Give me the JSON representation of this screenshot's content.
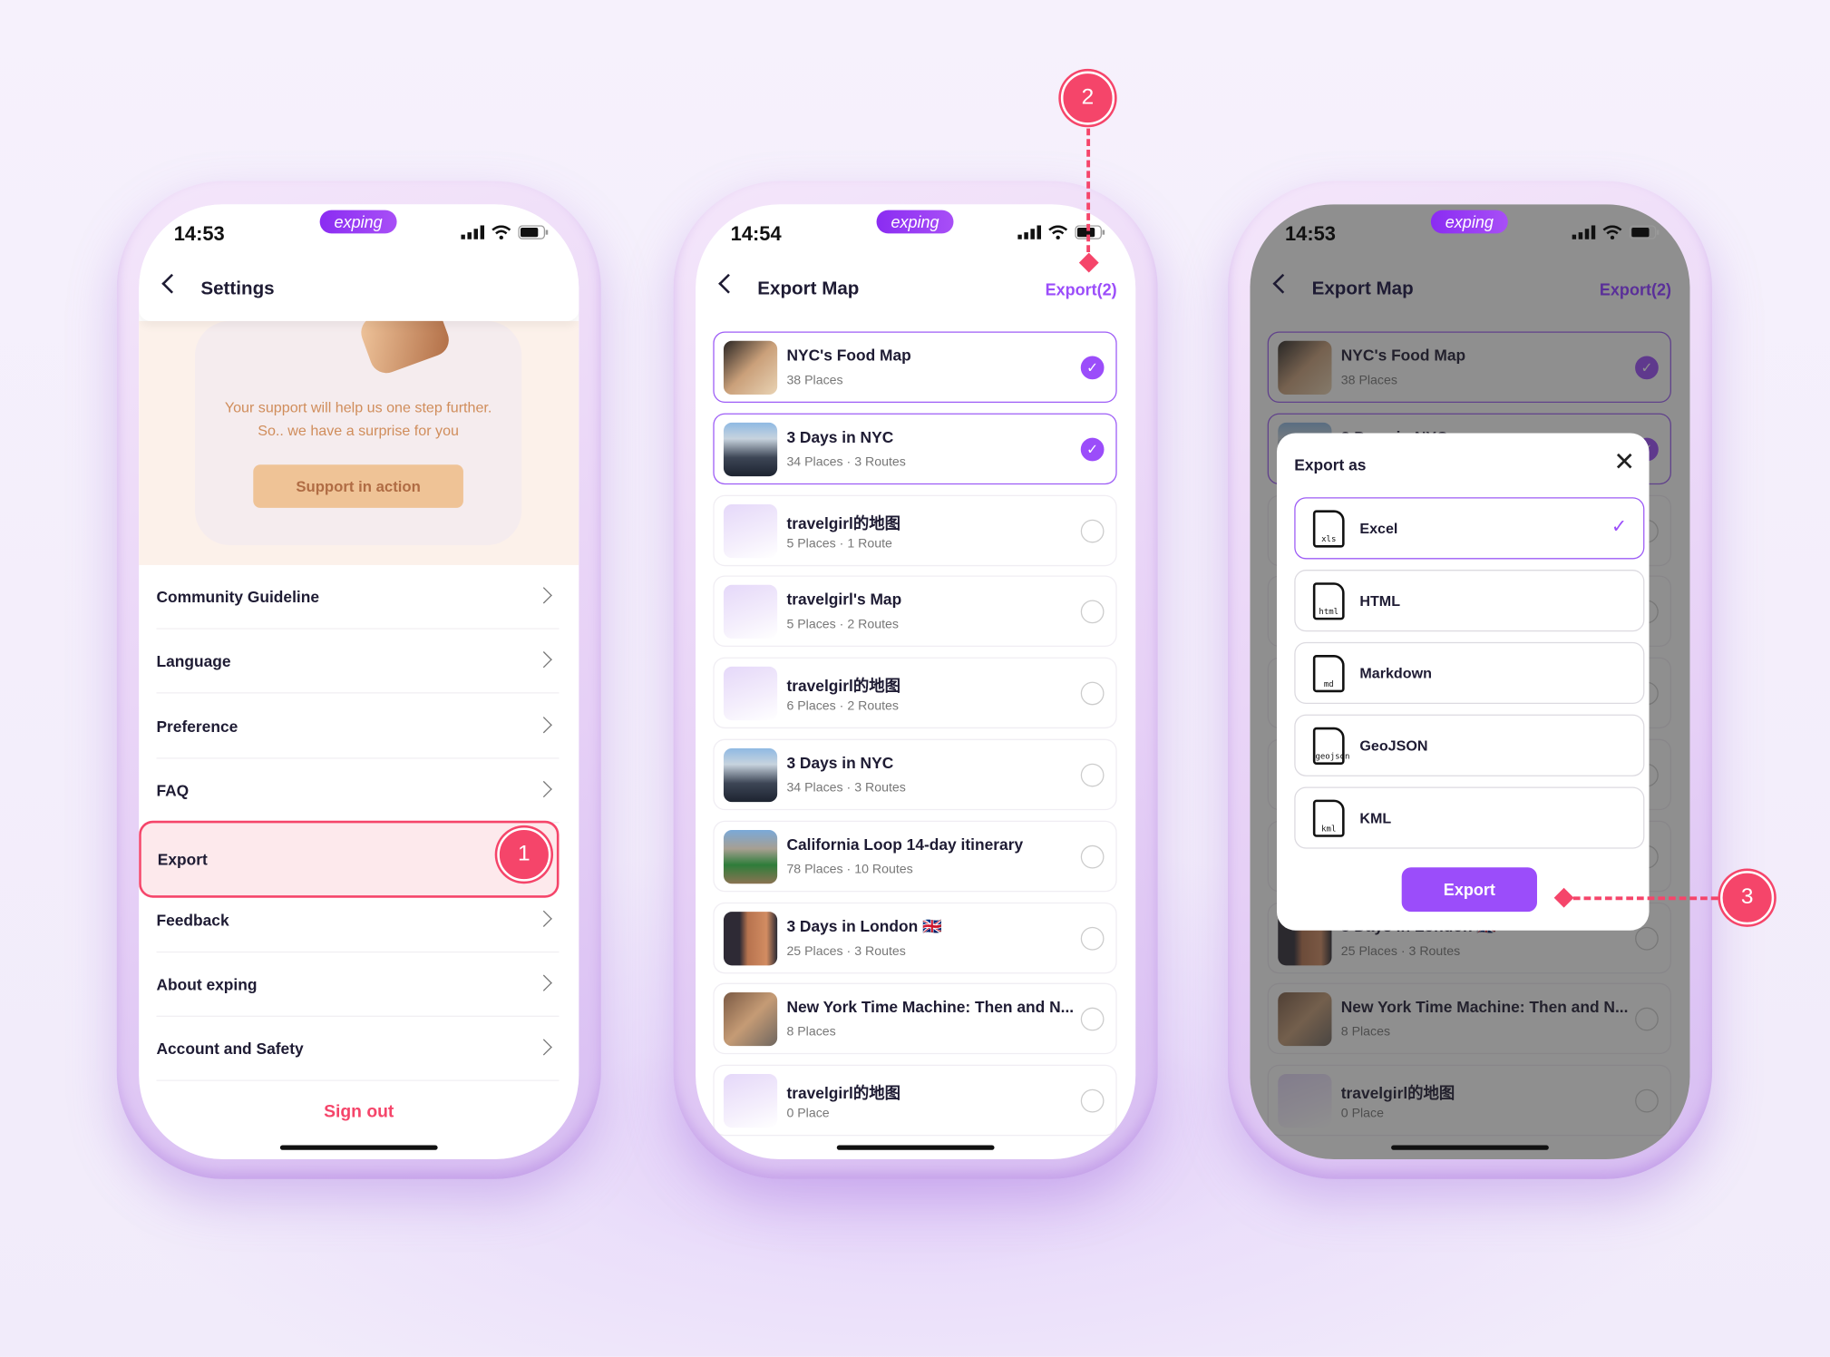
{
  "brand": {
    "pill": "exping",
    "accent": "#9b4dfa",
    "annotation": "#f5456a"
  },
  "settings": {
    "status_time": "14:53",
    "title": "Settings",
    "promo": {
      "line1": "Your support will help us one step further.",
      "line2": "So.. we have a surprise for you",
      "button": "Support in action"
    },
    "menu": [
      {
        "label": "Community Guideline"
      },
      {
        "label": "Language"
      },
      {
        "label": "Preference"
      },
      {
        "label": "FAQ"
      },
      {
        "label": "Export",
        "highlighted": true
      },
      {
        "label": "Feedback"
      },
      {
        "label": "About exping"
      },
      {
        "label": "Account and Safety"
      }
    ],
    "sign_out": "Sign out"
  },
  "export_map": {
    "status_time": "14:54",
    "title": "Export Map",
    "action": "Export(2)",
    "items": [
      {
        "title": "NYC's Food Map",
        "sub": "38 Places",
        "selected": true,
        "thumb": "food"
      },
      {
        "title": "3 Days in NYC",
        "sub": "34 Places · 3 Routes",
        "selected": true,
        "thumb": "city"
      },
      {
        "title": "travelgirl的地图",
        "sub": "5 Places · 1 Route",
        "selected": false,
        "thumb": "map"
      },
      {
        "title": "travelgirl's Map",
        "sub": "5 Places · 2 Routes",
        "selected": false,
        "thumb": "map"
      },
      {
        "title": "travelgirl的地图",
        "sub": "6 Places · 2 Routes",
        "selected": false,
        "thumb": "map"
      },
      {
        "title": "3 Days in NYC",
        "sub": "34 Places · 3 Routes",
        "selected": false,
        "thumb": "city"
      },
      {
        "title": "California Loop 14-day itinerary",
        "sub": "78 Places · 10 Routes",
        "selected": false,
        "thumb": "cal"
      },
      {
        "title": "3 Days in London 🇬🇧",
        "sub": "25 Places · 3 Routes",
        "selected": false,
        "thumb": "lon"
      },
      {
        "title": "New York Time Machine: Then and N...",
        "sub": "8 Places",
        "selected": false,
        "thumb": "nyv"
      },
      {
        "title": "travelgirl的地图",
        "sub": "0 Place",
        "selected": false,
        "thumb": "map"
      }
    ]
  },
  "export_dialog": {
    "status_time": "14:53",
    "title": "Export as",
    "options": [
      {
        "label": "Excel",
        "ext": "xls",
        "selected": true
      },
      {
        "label": "HTML",
        "ext": "html",
        "selected": false
      },
      {
        "label": "Markdown",
        "ext": "md",
        "selected": false
      },
      {
        "label": "GeoJSON",
        "ext": "geojson",
        "selected": false
      },
      {
        "label": "KML",
        "ext": "kml",
        "selected": false
      }
    ],
    "button": "Export"
  },
  "steps": [
    "1",
    "2",
    "3"
  ]
}
